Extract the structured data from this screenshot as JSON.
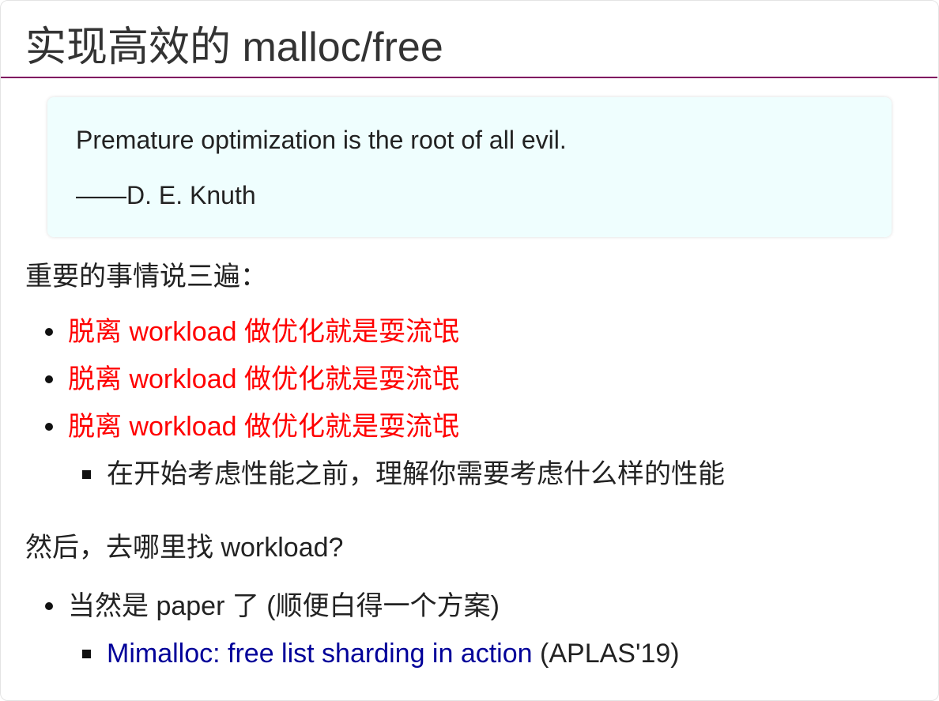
{
  "title": "实现高效的 malloc/free",
  "quote": {
    "text": "Premature optimization is the root of all evil.",
    "attribution": "——D. E. Knuth"
  },
  "section1": {
    "heading": "重要的事情说三遍：",
    "bullets": [
      "脱离 workload 做优化就是耍流氓",
      "脱离 workload 做优化就是耍流氓",
      "脱离 workload 做优化就是耍流氓"
    ],
    "sub_bullet": "在开始考虑性能之前，理解你需要考虑什么样的性能"
  },
  "section2": {
    "heading": "然后，去哪里找 workload?",
    "bullet": "当然是 paper 了 (顺便白得一个方案)",
    "sub_bullet": {
      "link_text": "Mimalloc: free list sharding in action",
      "suffix": "(APLAS'19)"
    }
  },
  "colors": {
    "title_rule": "#800060",
    "emphasis_text": "#ff0000",
    "link": "#000099",
    "quote_background": "#effefe"
  }
}
